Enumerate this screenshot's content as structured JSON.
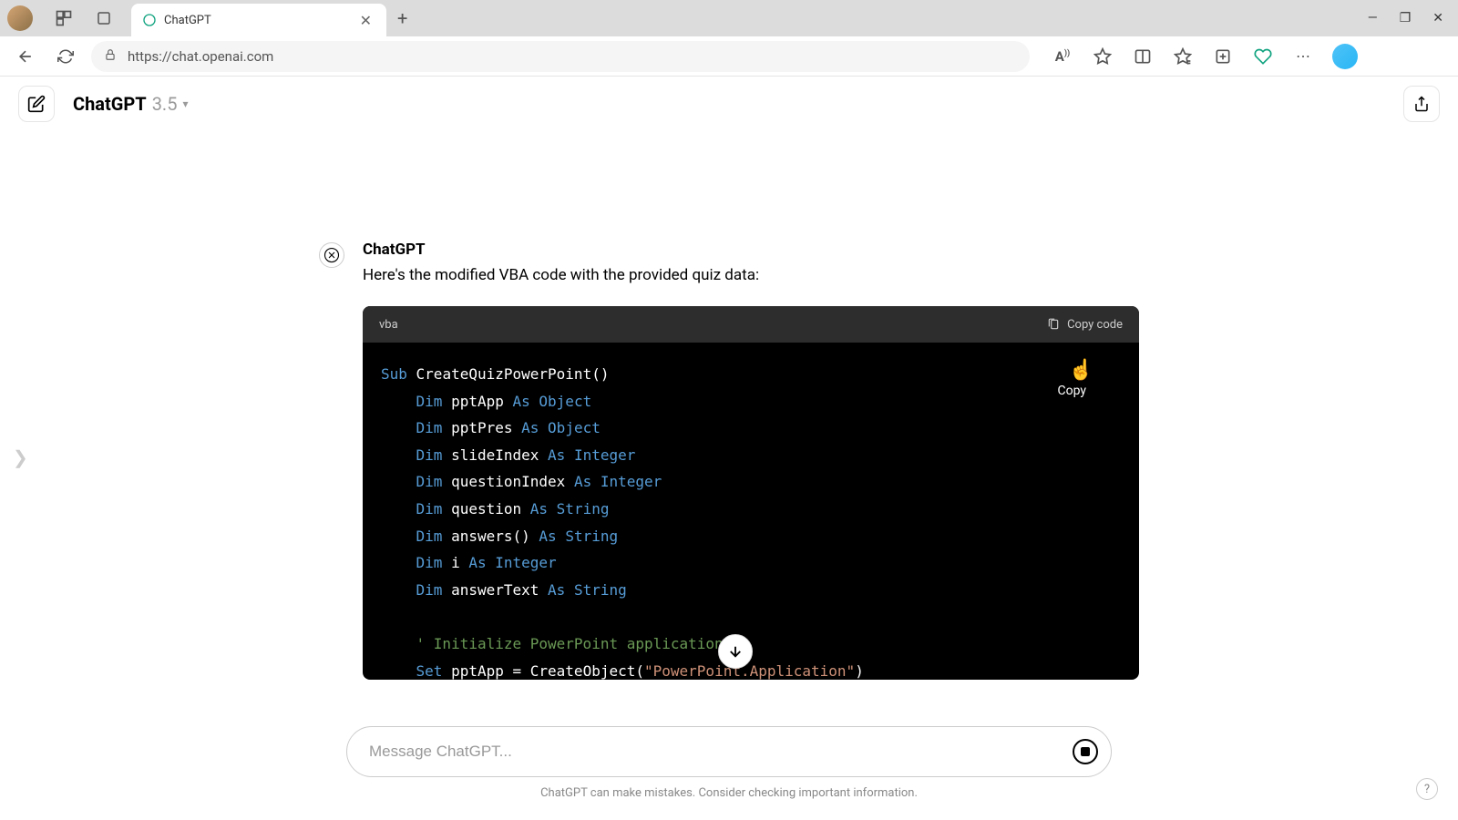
{
  "browser": {
    "tab_title": "ChatGPT",
    "url": "https://chat.openai.com"
  },
  "header": {
    "model_name": "ChatGPT",
    "model_version": "3.5"
  },
  "chat": {
    "sender": "ChatGPT",
    "intro_text": "Here's the modified VBA code with the provided quiz data:",
    "code_lang": "vba",
    "copy_label": "Copy code",
    "copy_tooltip": "Copy",
    "code_lines": [
      {
        "indent": 0,
        "tokens": [
          {
            "t": "kw",
            "v": "Sub"
          },
          {
            "t": "p",
            "v": " CreateQuizPowerPoint()"
          }
        ]
      },
      {
        "indent": 1,
        "tokens": [
          {
            "t": "kw",
            "v": "Dim"
          },
          {
            "t": "p",
            "v": " pptApp "
          },
          {
            "t": "kw",
            "v": "As"
          },
          {
            "t": "p",
            "v": " "
          },
          {
            "t": "ty",
            "v": "Object"
          }
        ]
      },
      {
        "indent": 1,
        "tokens": [
          {
            "t": "kw",
            "v": "Dim"
          },
          {
            "t": "p",
            "v": " pptPres "
          },
          {
            "t": "kw",
            "v": "As"
          },
          {
            "t": "p",
            "v": " "
          },
          {
            "t": "ty",
            "v": "Object"
          }
        ]
      },
      {
        "indent": 1,
        "tokens": [
          {
            "t": "kw",
            "v": "Dim"
          },
          {
            "t": "p",
            "v": " slideIndex "
          },
          {
            "t": "kw",
            "v": "As"
          },
          {
            "t": "p",
            "v": " "
          },
          {
            "t": "ty",
            "v": "Integer"
          }
        ]
      },
      {
        "indent": 1,
        "tokens": [
          {
            "t": "kw",
            "v": "Dim"
          },
          {
            "t": "p",
            "v": " questionIndex "
          },
          {
            "t": "kw",
            "v": "As"
          },
          {
            "t": "p",
            "v": " "
          },
          {
            "t": "ty",
            "v": "Integer"
          }
        ]
      },
      {
        "indent": 1,
        "tokens": [
          {
            "t": "kw",
            "v": "Dim"
          },
          {
            "t": "p",
            "v": " question "
          },
          {
            "t": "kw",
            "v": "As"
          },
          {
            "t": "p",
            "v": " "
          },
          {
            "t": "ty",
            "v": "String"
          }
        ]
      },
      {
        "indent": 1,
        "tokens": [
          {
            "t": "kw",
            "v": "Dim"
          },
          {
            "t": "p",
            "v": " answers() "
          },
          {
            "t": "kw",
            "v": "As"
          },
          {
            "t": "p",
            "v": " "
          },
          {
            "t": "ty",
            "v": "String"
          }
        ]
      },
      {
        "indent": 1,
        "tokens": [
          {
            "t": "kw",
            "v": "Dim"
          },
          {
            "t": "p",
            "v": " i "
          },
          {
            "t": "kw",
            "v": "As"
          },
          {
            "t": "p",
            "v": " "
          },
          {
            "t": "ty",
            "v": "Integer"
          }
        ]
      },
      {
        "indent": 1,
        "tokens": [
          {
            "t": "kw",
            "v": "Dim"
          },
          {
            "t": "p",
            "v": " answerText "
          },
          {
            "t": "kw",
            "v": "As"
          },
          {
            "t": "p",
            "v": " "
          },
          {
            "t": "ty",
            "v": "String"
          }
        ]
      },
      {
        "indent": 0,
        "tokens": []
      },
      {
        "indent": 1,
        "tokens": [
          {
            "t": "cm",
            "v": "' Initialize PowerPoint application"
          }
        ]
      },
      {
        "indent": 1,
        "tokens": [
          {
            "t": "kw",
            "v": "Set"
          },
          {
            "t": "p",
            "v": " pptApp = CreateObject("
          },
          {
            "t": "st",
            "v": "\"PowerPoint.Application\""
          },
          {
            "t": "p",
            "v": ")"
          }
        ]
      }
    ]
  },
  "input": {
    "placeholder": "Message ChatGPT...",
    "disclaimer": "ChatGPT can make mistakes. Consider checking important information."
  }
}
